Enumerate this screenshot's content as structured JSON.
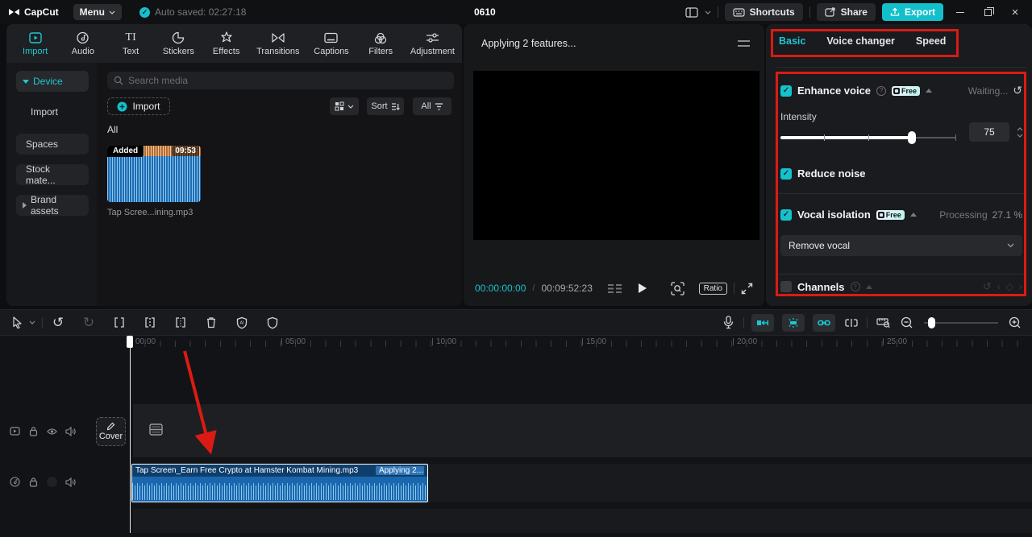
{
  "colors": {
    "accent": "#1fc7d2",
    "annotation_red": "#d91b14",
    "clip_blue": "#1a67ad",
    "export_teal": "#12c0cc"
  },
  "top_bar": {
    "logo": "CapCut",
    "menu_label": "Menu",
    "autosave_text": "Auto saved: 02:27:18",
    "project_title": "0610",
    "shortcuts_label": "Shortcuts",
    "share_label": "Share",
    "export_label": "Export"
  },
  "media_panel": {
    "tabs": [
      {
        "label": "Import",
        "active": true
      },
      {
        "label": "Audio"
      },
      {
        "label": "Text"
      },
      {
        "label": "Stickers"
      },
      {
        "label": "Effects"
      },
      {
        "label": "Transitions"
      },
      {
        "label": "Captions"
      },
      {
        "label": "Filters"
      },
      {
        "label": "Adjustment"
      }
    ],
    "sidebar": [
      {
        "label": "Device",
        "active": true
      },
      {
        "label": "Import"
      },
      {
        "label": "Spaces"
      },
      {
        "label": "Stock mate..."
      },
      {
        "label": "Brand assets"
      }
    ],
    "search_placeholder": "Search media",
    "import_button": "Import",
    "sort_label": "Sort",
    "filter_all_label": "All",
    "section_title": "All",
    "clip": {
      "badge": "Added",
      "duration": "09:53",
      "name": "Tap Scree...ining.mp3"
    }
  },
  "preview": {
    "status": "Applying 2 features...",
    "current_time": "00:00:00:00",
    "time_separator": "/",
    "total_time": "00:09:52:23",
    "ratio_label": "Ratio"
  },
  "properties": {
    "tabs": [
      {
        "label": "Basic",
        "active": true
      },
      {
        "label": "Voice changer"
      },
      {
        "label": "Speed"
      }
    ],
    "enhance_voice": {
      "label": "Enhance voice",
      "badge": "Free",
      "status": "Waiting...",
      "intensity_label": "Intensity",
      "intensity_value": "75"
    },
    "reduce_noise": {
      "label": "Reduce noise"
    },
    "vocal_isolation": {
      "label": "Vocal isolation",
      "badge": "Free",
      "status": "Processing",
      "progress": "27.1 %",
      "selected_option": "Remove vocal"
    },
    "channels": {
      "label": "Channels"
    }
  },
  "timeline": {
    "ruler_labels": [
      "00:00",
      "05:00",
      "10:00",
      "15:00",
      "20:00",
      "25:00"
    ],
    "cover_label": "Cover",
    "clip_title": "Tap Screen_Earn Free Crypto at Hamster Kombat Mining.mp3",
    "clip_status": "Applying 2..."
  }
}
